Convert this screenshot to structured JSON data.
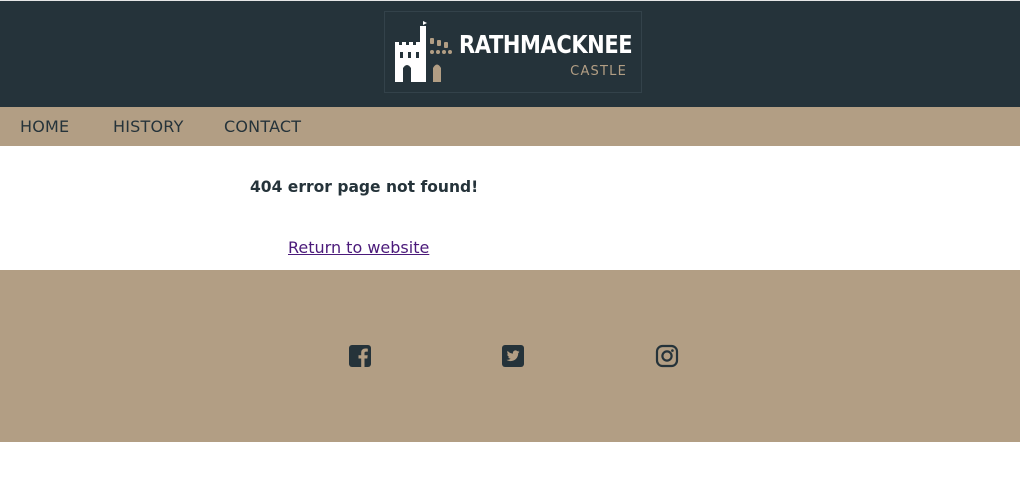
{
  "header": {
    "logo": {
      "title": "RATHMACKNEE",
      "subtitle": "CASTLE"
    }
  },
  "nav": {
    "items": [
      {
        "label": "HOME"
      },
      {
        "label": "HISTORY"
      },
      {
        "label": "CONTACT"
      }
    ]
  },
  "main": {
    "error_message": "404 error page not found!",
    "return_link": "Return to website"
  },
  "footer": {
    "social_icons": [
      "facebook-icon",
      "twitter-icon",
      "instagram-icon"
    ]
  },
  "colors": {
    "header_bg": "#25333a",
    "nav_bg": "#b29e84",
    "footer_bg": "#b29e84",
    "text": "#25333a",
    "link": "#4b1a7a",
    "logo_accent": "#b29e84"
  }
}
